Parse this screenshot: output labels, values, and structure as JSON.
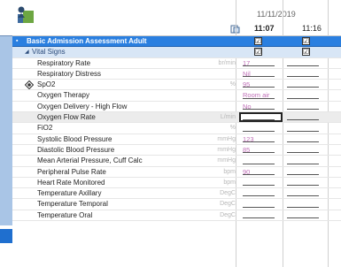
{
  "header": {
    "date": "11/11/2019",
    "times": [
      "11:07",
      "11:16"
    ]
  },
  "colors": {
    "section_bg": "#2a7fe0",
    "value_text": "#c070b8",
    "left_pane": "#a9c5e6"
  },
  "rows": [
    {
      "kind": "section",
      "label": "Basic Admission Assessment Adult",
      "chk1": "☑",
      "chk2": "☑"
    },
    {
      "kind": "subsection",
      "label": "Vital Signs",
      "chk1": "☑",
      "chk2": "☑"
    },
    {
      "label": "Respiratory Rate",
      "unit": "br/min",
      "v1": "17"
    },
    {
      "label": "Respiratory Distress",
      "unit": "",
      "v1": "Nil"
    },
    {
      "label": "SpO2",
      "unit": "%",
      "v1": "95",
      "icon": "target-icon"
    },
    {
      "label": "Oxygen Therapy",
      "unit": "",
      "v1": "Room air"
    },
    {
      "label": "Oxygen Delivery - High Flow",
      "unit": "",
      "v1": "No"
    },
    {
      "label": "Oxygen Flow Rate",
      "unit": "L/min",
      "v1": "",
      "selected": true
    },
    {
      "label": "FiO2",
      "unit": "%",
      "v1": ""
    },
    {
      "label": "Systolic Blood Pressure",
      "unit": "mmHg",
      "v1": "123"
    },
    {
      "label": "Diastolic Blood Pressure",
      "unit": "mmHg",
      "v1": "85"
    },
    {
      "label": "Mean Arterial Pressure, Cuff Calc",
      "unit": "mmHg",
      "v1": ""
    },
    {
      "label": "Peripheral Pulse Rate",
      "unit": "bpm",
      "v1": "90"
    },
    {
      "label": "Heart Rate Monitored",
      "unit": "bpm",
      "v1": ""
    },
    {
      "label": "Temperature Axillary",
      "unit": "DegC",
      "v1": ""
    },
    {
      "label": "Temperature Temporal",
      "unit": "DegC",
      "v1": ""
    },
    {
      "label": "Temperature Oral",
      "unit": "DegC",
      "v1": ""
    }
  ]
}
